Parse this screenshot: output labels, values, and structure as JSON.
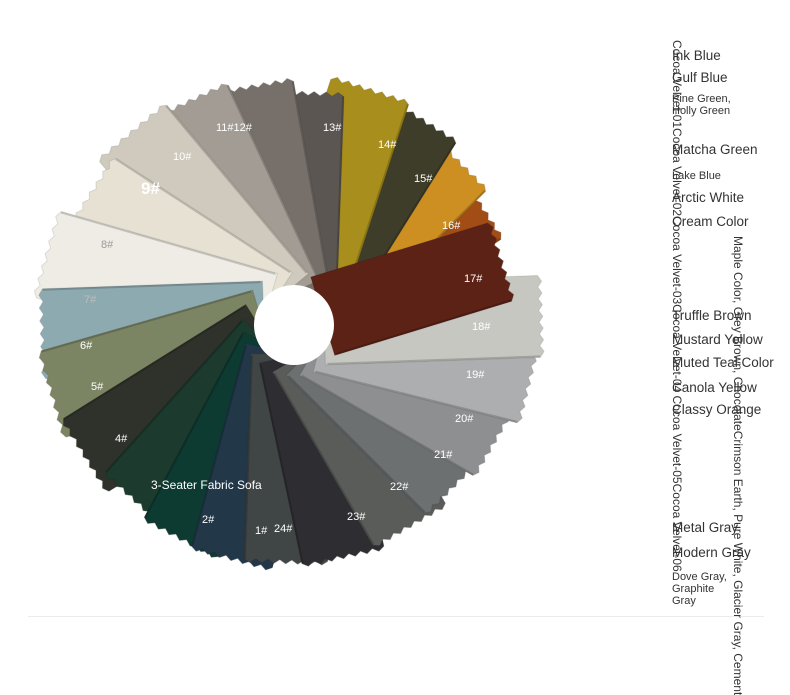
{
  "wheel": {
    "swatch_labels": [
      "1#",
      "2#",
      "3-Seater Fabric Sofa",
      "4#",
      "5#",
      "6#",
      "7#",
      "8#",
      "9#",
      "10#",
      "11#12#",
      "13#",
      "14#",
      "15#",
      "16#",
      "17#",
      "18#",
      "19#",
      "20#",
      "21#",
      "22#",
      "23#",
      "24#"
    ]
  },
  "colors": {
    "horizontal": [
      "Ink Blue",
      "Gulf Blue",
      "Pine Green, Holly Green",
      "Matcha Green",
      "Lake Blue",
      "Arctic White",
      "Cream Color",
      "Truffle Brown",
      "Mustard Yellow",
      "Muted Teal Color",
      "Canola Yellow",
      "Classy Orange",
      "Metal Gray",
      "Modern Gray",
      "Dove Gray, Graphite Gray"
    ],
    "vertical_1": "Cocoa Velvet-01Cocoa Velvet-02Cocoa Velvet-03Cocoa Velvet-04 Cocoa Velvet-05Cocoa Velvet-06",
    "vertical_2": "Maple Color, Grey Brown, ChocolateCrimson Earth, Pure White, Glacier Gray, Cement"
  },
  "swatch_colors": {
    "s1": "#23384a",
    "s2": "#113a30",
    "s3": "#1d3a2f",
    "s4": "#2f3329",
    "s5": "#7c8563",
    "s6": "#8eaab1",
    "s7": "#efece5",
    "s8": "#e7e1d3",
    "s9": "#cfcabd",
    "s10": "#a29c95",
    "s11": "#77706a",
    "s12": "#5b5652",
    "s13": "#a88e1c",
    "s14": "#3c3e2a",
    "s15": "#cd8e22",
    "s16": "#a24d15",
    "s17": "#5c2316",
    "s18": "#c6c7c1",
    "s19": "#acaeb0",
    "s20": "#8d8f91",
    "s21": "#6d6f71",
    "s22": "#5a5c5a",
    "s23": "#2f2f31",
    "s24": "#404444"
  }
}
